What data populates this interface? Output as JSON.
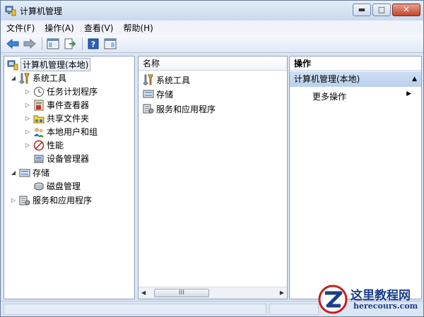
{
  "window": {
    "title": "计算机管理",
    "min_glyph": "▬",
    "max_glyph": "□",
    "close_glyph": "✕"
  },
  "menu": [
    "文件(F)",
    "操作(A)",
    "查看(V)",
    "帮助(H)"
  ],
  "tree": {
    "root": "计算机管理(本地)",
    "system_tools": "系统工具",
    "task_scheduler": "任务计划程序",
    "event_viewer": "事件查看器",
    "shared_folders": "共享文件夹",
    "local_users": "本地用户和组",
    "performance": "性能",
    "device_manager": "设备管理器",
    "storage": "存储",
    "disk_management": "磁盘管理",
    "services": "服务和应用程序"
  },
  "middle": {
    "header": "名称",
    "items": [
      "系统工具",
      "存储",
      "服务和应用程序"
    ],
    "scroll_grip": "III"
  },
  "actions": {
    "title": "操作",
    "section": "计算机管理(本地)",
    "more": "更多操作"
  },
  "watermark": {
    "name": "这里教程网",
    "url": "herecours.com"
  }
}
